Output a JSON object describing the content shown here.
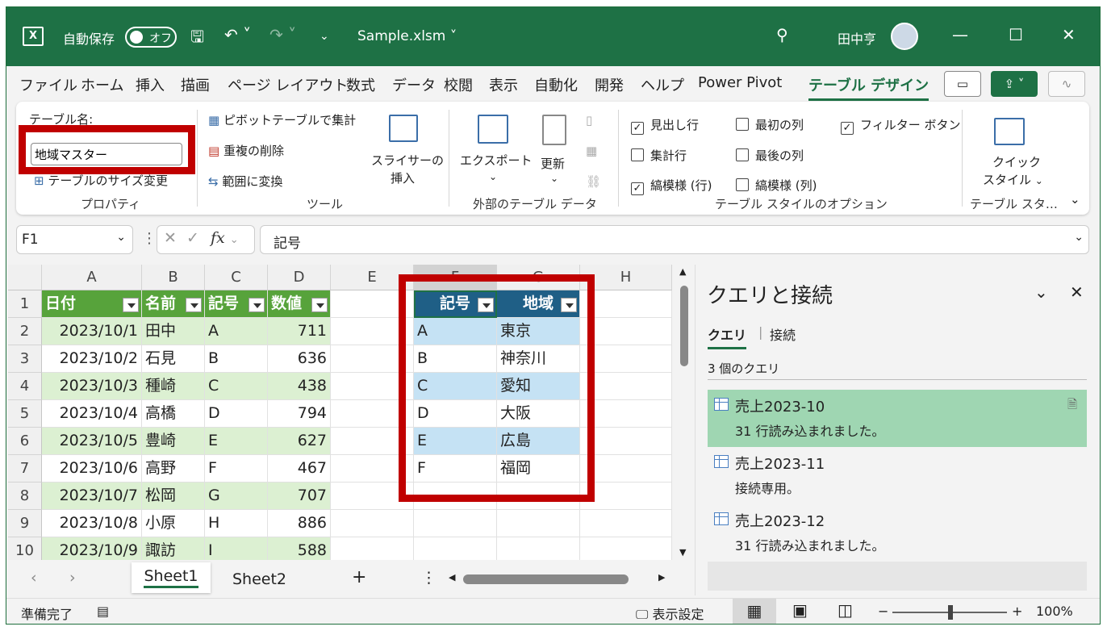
{
  "titlebar": {
    "app_icon": "X",
    "autosave_label": "自動保存",
    "autosave_state": "オフ",
    "filename": "Sample.xlsm",
    "user_name": "田中亨"
  },
  "tabs": [
    "ファイル",
    "ホーム",
    "挿入",
    "描画",
    "ページ レイアウト",
    "数式",
    "データ",
    "校閲",
    "表示",
    "自動化",
    "開発",
    "ヘルプ",
    "Power Pivot",
    "テーブル デザイン"
  ],
  "ribbon": {
    "table_name_label": "テーブル名:",
    "table_name_value": "地域マスター",
    "resize_table": "テーブルのサイズ変更",
    "group_properties": "プロパティ",
    "pivot_summary": "ピボットテーブルで集計",
    "remove_duplicates": "重複の削除",
    "convert_to_range": "範囲に変換",
    "slicer_line1": "スライサーの",
    "slicer_line2": "挿入",
    "group_tools": "ツール",
    "export": "エクスポート",
    "refresh": "更新",
    "group_external": "外部のテーブル データ",
    "opt_header_row": "見出し行",
    "opt_total_row": "集計行",
    "opt_banded_rows": "縞模様 (行)",
    "opt_first_col": "最初の列",
    "opt_last_col": "最後の列",
    "opt_banded_cols": "縞模様 (列)",
    "opt_filter_btn": "フィルター ボタン",
    "group_style_options": "テーブル スタイルのオプション",
    "quick_style_line1": "クイック",
    "quick_style_line2": "スタイル",
    "group_styles": "テーブル スタ…"
  },
  "formula_bar": {
    "name_box": "F1",
    "fx": "fx",
    "formula": "記号"
  },
  "grid": {
    "columns": [
      "A",
      "B",
      "C",
      "D",
      "E",
      "F",
      "G",
      "H"
    ],
    "rows": [
      "1",
      "2",
      "3",
      "4",
      "5",
      "6",
      "7",
      "8",
      "9",
      "10"
    ],
    "table1_headers": [
      "日付",
      "名前",
      "記号",
      "数値"
    ],
    "table1_rows": [
      [
        "2023/10/1",
        "田中",
        "A",
        "711"
      ],
      [
        "2023/10/2",
        "石見",
        "B",
        "636"
      ],
      [
        "2023/10/3",
        "種崎",
        "C",
        "438"
      ],
      [
        "2023/10/4",
        "高橋",
        "D",
        "794"
      ],
      [
        "2023/10/5",
        "豊崎",
        "E",
        "627"
      ],
      [
        "2023/10/6",
        "高野",
        "F",
        "467"
      ],
      [
        "2023/10/7",
        "松岡",
        "G",
        "707"
      ],
      [
        "2023/10/8",
        "小原",
        "H",
        "886"
      ],
      [
        "2023/10/9",
        "諏訪",
        "I",
        "588"
      ]
    ],
    "table2_headers": [
      "記号",
      "地域"
    ],
    "table2_rows": [
      [
        "A",
        "東京"
      ],
      [
        "B",
        "神奈川"
      ],
      [
        "C",
        "愛知"
      ],
      [
        "D",
        "大阪"
      ],
      [
        "E",
        "広島"
      ],
      [
        "F",
        "福岡"
      ]
    ]
  },
  "sheets": [
    "Sheet1",
    "Sheet2"
  ],
  "pane": {
    "title": "クエリと接続",
    "tab_queries": "クエリ",
    "tab_connections": "接続",
    "count": "3 個のクエリ",
    "queries": [
      {
        "name": "売上2023-10",
        "status": "31 行読み込まれました。"
      },
      {
        "name": "売上2023-11",
        "status": "接続専用。"
      },
      {
        "name": "売上2023-12",
        "status": "31 行読み込まれました。"
      }
    ]
  },
  "status": {
    "ready": "準備完了",
    "display_settings": "表示設定",
    "zoom": "100%"
  },
  "colors": {
    "excel_green": "#1e7145",
    "table1_header": "#57a33b",
    "table2_header": "#1f5f86",
    "highlight_red": "#c00000"
  }
}
